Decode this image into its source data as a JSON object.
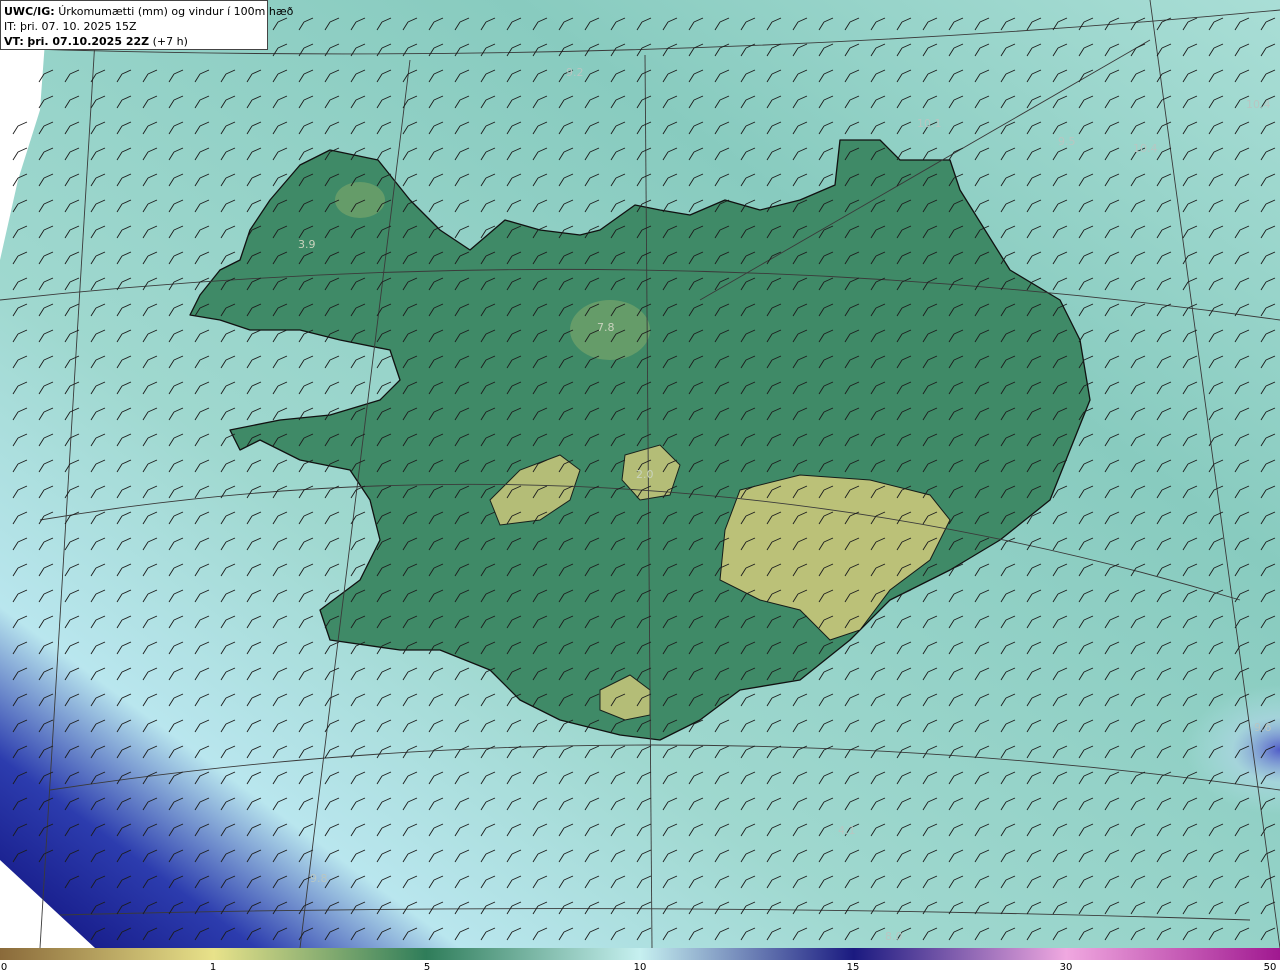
{
  "header": {
    "model": "UWC/IG:",
    "title": "Úrkomumætti (mm) og vindur í 100m hæð",
    "it_label": "IT:",
    "it_value": "þri. 07. 10. 2025 15Z",
    "vt_label": "VT:",
    "vt_value": "þri. 07.10.2025 22Z",
    "vt_offset": "(+7 h)"
  },
  "value_labels": [
    {
      "text": "9.2"
    },
    {
      "text": "10.1"
    },
    {
      "text": "9.5"
    },
    {
      "text": "10.4"
    },
    {
      "text": "10.4"
    },
    {
      "text": "3.9"
    },
    {
      "text": "7.8"
    },
    {
      "text": "2.0"
    },
    {
      "text": "9.6"
    },
    {
      "text": "9.8"
    },
    {
      "text": "8.0"
    },
    {
      "text": "4.1"
    }
  ],
  "colorbar": {
    "ticks": [
      {
        "label": "0",
        "value": 0
      },
      {
        "label": "1",
        "value": 1
      },
      {
        "label": "5",
        "value": 5
      },
      {
        "label": "10",
        "value": 10
      },
      {
        "label": "15",
        "value": 15
      },
      {
        "label": "30",
        "value": 30
      },
      {
        "label": "50",
        "value": 50
      }
    ],
    "colors": [
      "#8a6a3a",
      "#e8e28a",
      "#2f7d5a",
      "#c6f0f0",
      "#1a1a80",
      "#f0a8e0",
      "#a01890"
    ]
  },
  "colors": {
    "sea": "#a9dcd3",
    "land": "#3f8a67",
    "highland": "#c9c77a",
    "heavy_precip": "#14148c",
    "coast": "#111111",
    "grid": "#3a3a3a"
  }
}
